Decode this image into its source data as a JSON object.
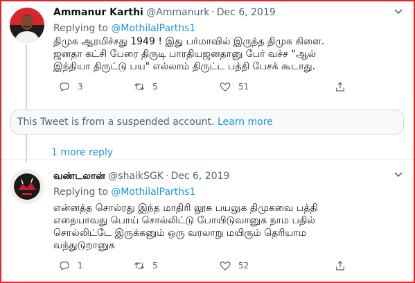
{
  "tweets": [
    {
      "name": "Ammanur Karthi",
      "handle": "@Ammanurk",
      "separator": "·",
      "date": "Dec 6, 2019",
      "reply_prefix": "Replying to",
      "reply_to": "@MothilalParths1",
      "lines": [
        "திமுக ஆரமிச்சது 1949 ! இது பர்மாவில் இருந்த திமுக கிளை.",
        "ஜனதா கட்சி பேரை திருடி பாரதியஜனதானு பேர் வச்ச \"ஆல்",
        "இந்தியா திருட்டு பய\" எல்லாம் திருட்ட பத்தி பேசக் கூடாது."
      ],
      "replies": "3",
      "retweets": "5",
      "likes": "51"
    },
    {
      "name": "வண்டலான்",
      "handle": "@shaikSGK",
      "separator": "·",
      "date": "Dec 6, 2019",
      "reply_prefix": "Replying to",
      "reply_to": "@MothilalParths1",
      "lines": [
        "என்னத்த சொல்ரது இந்த மாதிரி லூசு பயலுக திமுகவை பத்தி",
        "எதையாவது பொய் சொல்லிட்டு போயிடுவானுக நாம பதில்",
        "சொல்லிட்டே இருக்கனும் ஒரு வரலாறு மயிரும் தெரியாம",
        "வந்துடுறானுக"
      ],
      "replies": "1",
      "retweets": "5",
      "likes": "52"
    }
  ],
  "quote": {
    "text": "This Tweet is from a suspended account.",
    "link": "Learn more"
  },
  "more_replies": "1 more reply",
  "colors": {
    "accent": "#1b95e0",
    "border_highlight": "#e0262b",
    "muted": "#536471"
  },
  "icons": {
    "reply": "reply-icon",
    "retweet": "retweet-icon",
    "like": "heart-icon",
    "share": "share-icon",
    "menu": "chevron-down-icon"
  }
}
